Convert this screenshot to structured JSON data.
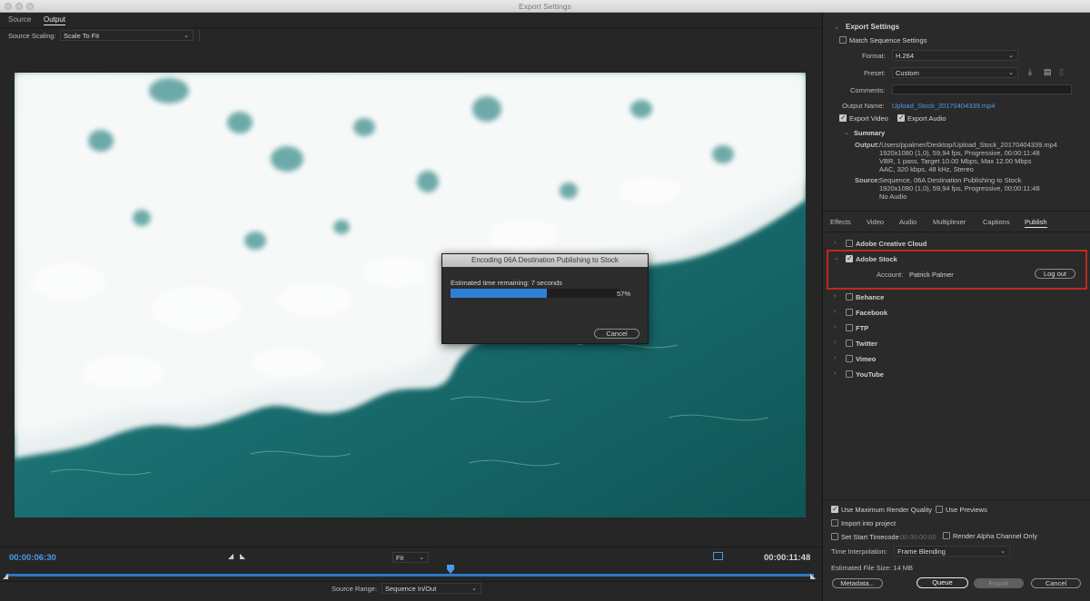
{
  "window": {
    "title": "Export Settings"
  },
  "left": {
    "tabs": [
      "Source",
      "Output"
    ],
    "source_scaling_label": "Source Scaling:",
    "source_scaling_value": "Scale To Fit",
    "timecode_start": "00:00:06:30",
    "timecode_end": "00:00:11:48",
    "zoom_value": "Fit",
    "source_range_label": "Source Range:",
    "source_range_value": "Sequence In/Out",
    "playhead_fraction": 0.55
  },
  "modal": {
    "title": "Encoding 06A Destination Publishing to Stock",
    "status": "Estimated time remaining: 7 seconds",
    "progress_percent": 57,
    "progress_text": "57%",
    "cancel": "Cancel"
  },
  "export": {
    "section_title": "Export Settings",
    "match_sequence": "Match Sequence Settings",
    "format_label": "Format:",
    "format_value": "H.264",
    "preset_label": "Preset:",
    "preset_value": "Custom",
    "comments_label": "Comments:",
    "output_name_label": "Output Name:",
    "output_name_value": "Upload_Stock_20170404339.mp4",
    "export_video": "Export Video",
    "export_audio": "Export Audio",
    "summary_title": "Summary",
    "output_label": "Output:",
    "output_lines": [
      "/Users/ppalmer/Desktop/Upload_Stock_20170404339.mp4",
      "1920x1080 (1,0), 59,94 fps, Progressive, 00:00:11:48",
      "VBR, 1 pass, Target 10.00 Mbps, Max 12.00 Mbps",
      "AAC, 320 kbps, 48 kHz, Stereo"
    ],
    "source_label": "Source:",
    "source_lines": [
      "Sequence, 06A Destination Publishing to Stock",
      "1920x1080 (1,0), 59,94 fps, Progressive, 00:00:11:48",
      "No Audio"
    ]
  },
  "tabs": [
    "Effects",
    "Video",
    "Audio",
    "Multiplexer",
    "Captions",
    "Publish"
  ],
  "publish": {
    "items": [
      {
        "label": "Adobe Creative Cloud",
        "checked": false
      },
      {
        "label": "Adobe Stock",
        "checked": true
      },
      {
        "label": "Behance",
        "checked": false
      },
      {
        "label": "Facebook",
        "checked": false
      },
      {
        "label": "FTP",
        "checked": false
      },
      {
        "label": "Twitter",
        "checked": false
      },
      {
        "label": "Vimeo",
        "checked": false
      },
      {
        "label": "YouTube",
        "checked": false
      }
    ],
    "account_label": "Account:",
    "account_value": "Patrick Palmer",
    "logout": "Log out"
  },
  "bottom": {
    "max_render_quality": "Use Maximum Render Quality",
    "use_previews": "Use Previews",
    "import_into_project": "Import into project",
    "set_start_timecode": "Set Start Timecode",
    "start_timecode_value": "00:00:00:00",
    "render_alpha": "Render Alpha Channel Only",
    "time_interp_label": "Time Interpolation:",
    "time_interp_value": "Frame Blending",
    "file_size": "Estimated File Size:  14 MB",
    "metadata": "Metadata...",
    "queue": "Queue",
    "export": "Export",
    "cancel": "Cancel"
  },
  "colors": {
    "accent": "#2e80d6",
    "highlight": "#c0281f",
    "timecode": "#4a9ae6"
  }
}
